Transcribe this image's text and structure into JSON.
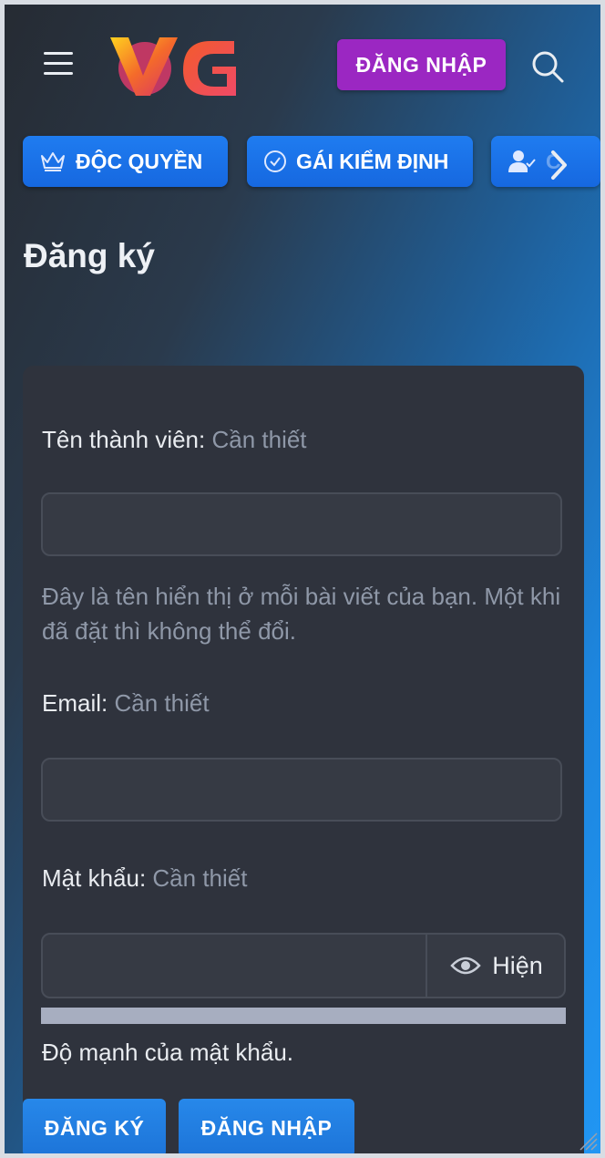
{
  "header": {
    "logo_text": "VG",
    "login_button": "ĐĂNG NHẬP"
  },
  "nav": {
    "items": [
      {
        "label": "ĐỘC QUYỀN",
        "icon": "crown-icon"
      },
      {
        "label": "GÁI KIỂM ĐỊNH",
        "icon": "check-circle-icon"
      },
      {
        "label": "C",
        "icon": "user-check-icon"
      }
    ]
  },
  "page": {
    "title": "Đăng ký"
  },
  "form": {
    "username": {
      "label": "Tên thành viên:",
      "required": "Cần thiết",
      "hint": "Đây là tên hiển thị ở mỗi bài viết của bạn. Một khi đã đặt thì không thể đổi."
    },
    "email": {
      "label": "Email:",
      "required": "Cần thiết"
    },
    "password": {
      "label": "Mật khẩu:",
      "required": "Cần thiết",
      "toggle": "Hiện",
      "strength": "Độ mạnh của mật khẩu."
    }
  },
  "footer": {
    "register": "ĐĂNG KÝ",
    "login": "ĐĂNG NHẬP"
  },
  "colors": {
    "accent_blue": "#1f7cf0",
    "login_purple": "#9b27c2",
    "card_bg": "#2f333d"
  }
}
